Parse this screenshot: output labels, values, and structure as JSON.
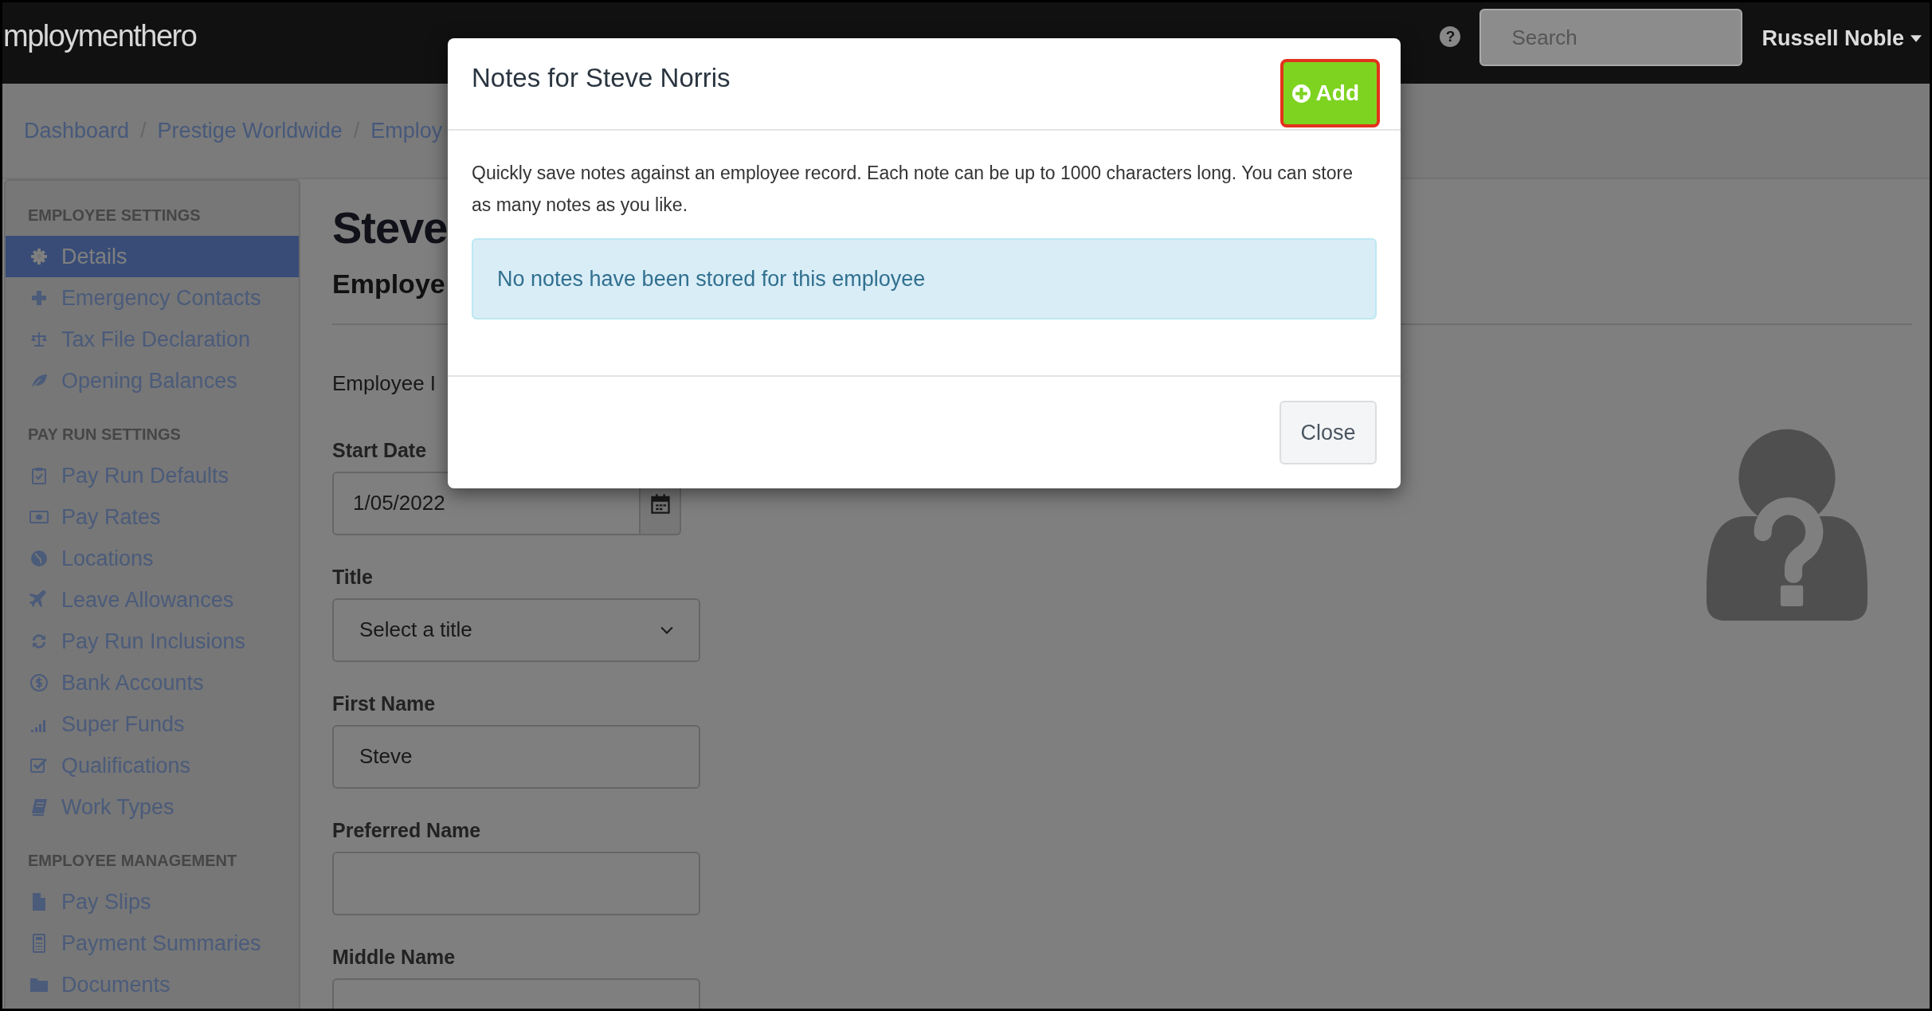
{
  "top_bar": {
    "logo": "mploymenthero",
    "help_button": "?",
    "search": {
      "placeholder": "Search"
    },
    "user_menu": "Russell Noble"
  },
  "breadcrumb": {
    "separator": "/",
    "items": [
      "Dashboard",
      "Prestige Worldwide",
      "Employ"
    ]
  },
  "sidebar": {
    "sections": [
      {
        "heading": "EMPLOYEE SETTINGS",
        "items": [
          {
            "label": "Details",
            "kind": "gear",
            "selected": true
          },
          {
            "label": "Emergency Contacts",
            "kind": "plus",
            "selected": false
          },
          {
            "label": "Tax File Declaration",
            "kind": "scales",
            "selected": false
          },
          {
            "label": "Opening Balances",
            "kind": "leaf",
            "selected": false
          }
        ]
      },
      {
        "heading": "PAY RUN SETTINGS",
        "items": [
          {
            "label": "Pay Run Defaults",
            "kind": "clipboard",
            "selected": false
          },
          {
            "label": "Pay Rates",
            "kind": "banknote",
            "selected": false
          },
          {
            "label": "Locations",
            "kind": "globe",
            "selected": false
          },
          {
            "label": "Leave Allowances",
            "kind": "airplane",
            "selected": false
          },
          {
            "label": "Pay Run Inclusions",
            "kind": "refresh",
            "selected": false
          },
          {
            "label": "Bank Accounts",
            "kind": "dollar",
            "selected": false
          },
          {
            "label": "Super Funds",
            "kind": "signal",
            "selected": false
          },
          {
            "label": "Qualifications",
            "kind": "checkbox",
            "selected": false
          },
          {
            "label": "Work Types",
            "kind": "book",
            "selected": false
          }
        ]
      },
      {
        "heading": "EMPLOYEE MANAGEMENT",
        "items": [
          {
            "label": "Pay Slips",
            "kind": "file",
            "selected": false
          },
          {
            "label": "Payment Summaries",
            "kind": "calculator",
            "selected": false
          },
          {
            "label": "Documents",
            "kind": "folder",
            "selected": false
          }
        ]
      }
    ]
  },
  "page": {
    "heading": "Steve",
    "subheading": "Employe",
    "employee_id_label": "Employee I",
    "fields": [
      {
        "kind": "date",
        "label": "Start Date",
        "value": "1/05/2022"
      },
      {
        "kind": "select",
        "label": "Title",
        "value": "Select a title"
      },
      {
        "kind": "text",
        "label": "First Name",
        "value": "Steve"
      },
      {
        "kind": "text",
        "label": "Preferred Name"
      },
      {
        "kind": "text",
        "label": "Middle Name"
      }
    ]
  },
  "modal": {
    "title": "Notes for Steve Norris",
    "add_button": {
      "label": "Add",
      "highlighted": true
    },
    "description": "Quickly save notes against an employee record. Each note can be up to 1000 characters long. You can store as many notes as you like.",
    "alert": "No notes have been stored for this employee",
    "close_button": "Close"
  }
}
